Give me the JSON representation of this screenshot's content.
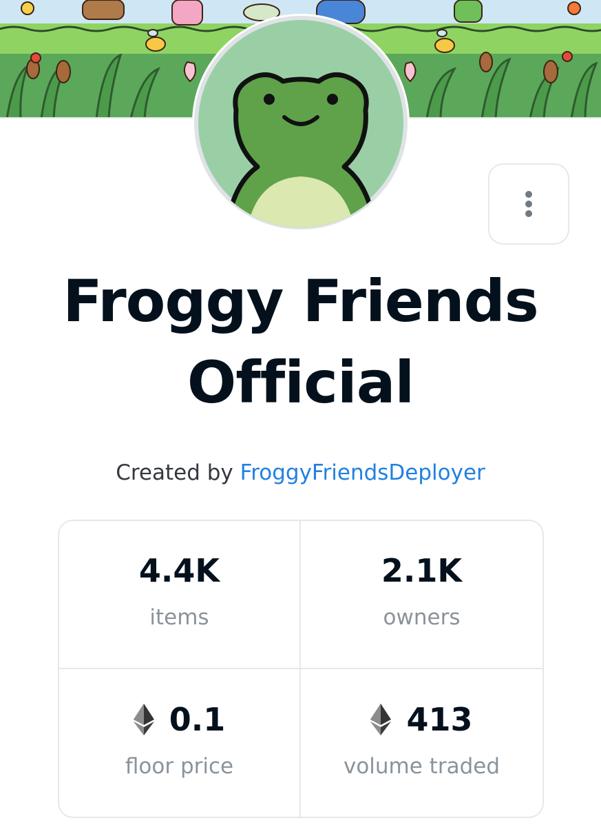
{
  "collection": {
    "name": "Froggy Friends Official",
    "created_by_label": "Created by",
    "creator": "FroggyFriendsDeployer"
  },
  "stats": [
    {
      "value": "4.4K",
      "label": "items",
      "currency_icon": ""
    },
    {
      "value": "2.1K",
      "label": "owners",
      "currency_icon": ""
    },
    {
      "value": "0.1",
      "label": "floor price",
      "currency_icon": "ethereum-icon"
    },
    {
      "value": "413",
      "label": "volume traded",
      "currency_icon": "ethereum-icon"
    }
  ],
  "menu": {
    "icon": "more-vertical-icon"
  },
  "colors": {
    "title": "#04111d",
    "link": "#2081e2",
    "muted": "#8a939b",
    "border": "#e5e8eb",
    "avatar_bg": "#9acfa6",
    "frog_green": "#5fa24a",
    "frog_belly": "#dbe8b0"
  }
}
